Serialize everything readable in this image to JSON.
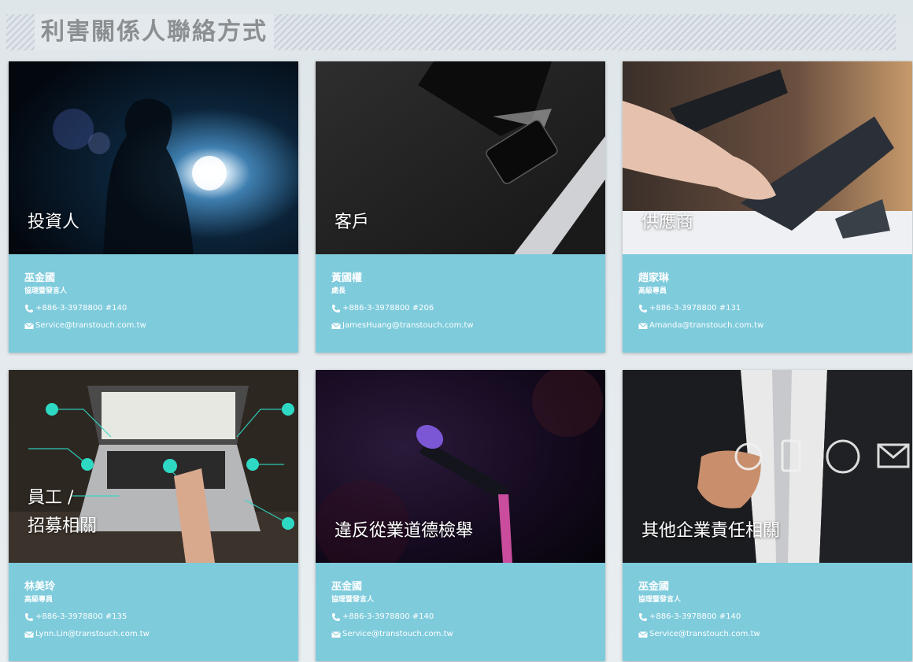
{
  "page": {
    "title": "利害關係人聯絡方式"
  },
  "cards": [
    {
      "category": "投資人",
      "name": "巫金國",
      "role": "協理暨發言人",
      "phone": "+886-3-3978800 #140",
      "email": "Service@transtouch.com.tw",
      "image": "investor-backlit-photo"
    },
    {
      "category": "客戶",
      "name": "黃國權",
      "role": "處長",
      "phone": "+886-3-3978800 #206",
      "email": "JamesHuang@transtouch.com.tw",
      "image": "laptop-phone-desk-photo"
    },
    {
      "category": "供應商",
      "name": "趙家琳",
      "role": "高級專員",
      "phone": "+886-3-3978800 #131",
      "email": "Amanda@transtouch.com.tw",
      "image": "desk-telephone-photo"
    },
    {
      "category": "員工 /",
      "category_line2": "招募相關",
      "name": "林美玲",
      "role": "高級專員",
      "phone": "+886-3-3978800 #135",
      "email": "Lynn.Lin@transtouch.com.tw",
      "image": "network-laptop-photo"
    },
    {
      "category": "違反從業道德檢舉",
      "name": "巫金國",
      "role": "協理暨發言人",
      "phone": "+886-3-3978800 #140",
      "email": "Service@transtouch.com.tw",
      "image": "microphone-stage-photo"
    },
    {
      "category": "其他企業責任相關",
      "name": "巫金國",
      "role": "協理暨發言人",
      "phone": "+886-3-3978800 #140",
      "email": "Service@transtouch.com.tw",
      "image": "contact-icons-businessman-photo"
    }
  ],
  "icons": {
    "phone": "phone-icon",
    "email": "envelope-icon"
  },
  "colors": {
    "card_body": "#7ecbdc",
    "header_text": "#8c8f92",
    "background": "#e3e9ec"
  }
}
